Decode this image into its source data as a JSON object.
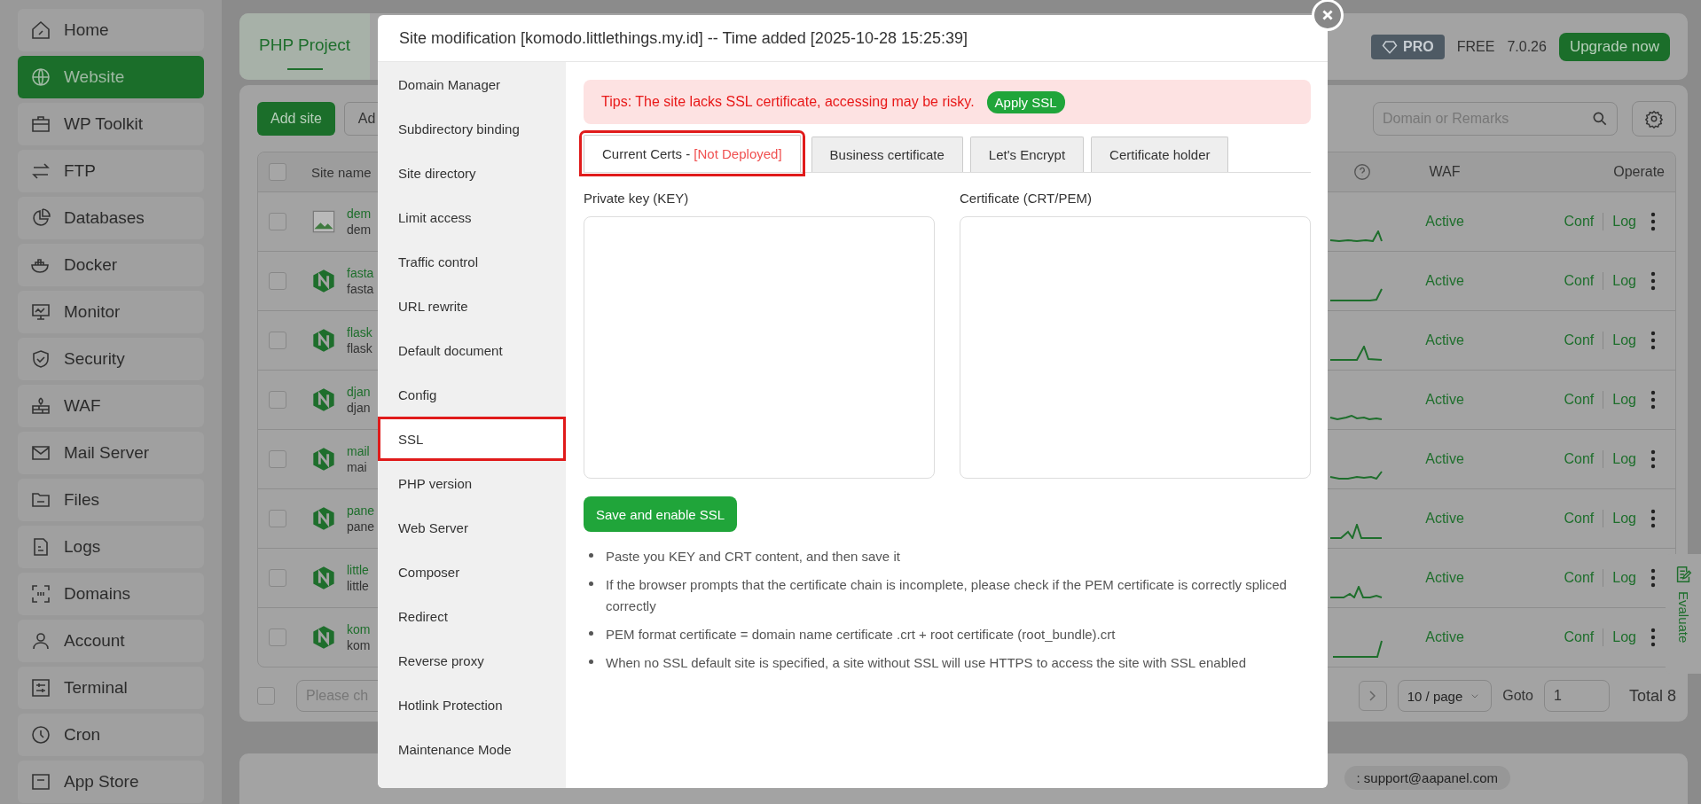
{
  "sidebar": {
    "items": [
      {
        "label": "Home",
        "selected": false
      },
      {
        "label": "Website",
        "selected": true
      },
      {
        "label": "WP Toolkit",
        "selected": false
      },
      {
        "label": "FTP",
        "selected": false
      },
      {
        "label": "Databases",
        "selected": false
      },
      {
        "label": "Docker",
        "selected": false
      },
      {
        "label": "Monitor",
        "selected": false
      },
      {
        "label": "Security",
        "selected": false
      },
      {
        "label": "WAF",
        "selected": false
      },
      {
        "label": "Mail Server",
        "selected": false
      },
      {
        "label": "Files",
        "selected": false
      },
      {
        "label": "Logs",
        "selected": false
      },
      {
        "label": "Domains",
        "selected": false
      },
      {
        "label": "Account",
        "selected": false
      },
      {
        "label": "Terminal",
        "selected": false
      },
      {
        "label": "Cron",
        "selected": false
      },
      {
        "label": "App Store",
        "selected": false
      }
    ]
  },
  "header": {
    "tabs": [
      {
        "label": "PHP Project",
        "selected": true
      }
    ],
    "badge": "PRO",
    "edition": "FREE",
    "version": "7.0.26",
    "upgrade_button": "Upgrade now"
  },
  "toolbar": {
    "add_button": "Add site",
    "second_button": "Ad",
    "search": {
      "placeholder": "Domain or Remarks"
    }
  },
  "table": {
    "checked": false,
    "columns": [
      "Site name",
      "WAF",
      "Operate"
    ],
    "rows": [
      {
        "kind": "image",
        "name": "dem",
        "note": "dem",
        "waf": "Active",
        "actions": [
          "Conf",
          "Log"
        ],
        "checked": false
      },
      {
        "kind": "hexagon",
        "name": "fasta",
        "note": "fasta",
        "waf": "Active",
        "actions": [
          "Conf",
          "Log"
        ],
        "checked": false
      },
      {
        "kind": "hexagon",
        "name": "flask",
        "note": "flask",
        "waf": "Active",
        "actions": [
          "Conf",
          "Log"
        ],
        "checked": false
      },
      {
        "kind": "hexagon",
        "name": "djan",
        "note": "djan",
        "waf": "Active",
        "actions": [
          "Conf",
          "Log"
        ],
        "checked": false
      },
      {
        "kind": "hexagon",
        "name": "mail",
        "note": "mai",
        "waf": "Active",
        "actions": [
          "Conf",
          "Log"
        ],
        "checked": false
      },
      {
        "kind": "hexagon",
        "name": "pane",
        "note": "pane",
        "waf": "Active",
        "actions": [
          "Conf",
          "Log"
        ],
        "checked": false
      },
      {
        "kind": "hexagon",
        "name": "little",
        "note": "little",
        "waf": "Active",
        "actions": [
          "Conf",
          "Log"
        ],
        "checked": false
      },
      {
        "kind": "hexagon",
        "name": "kom",
        "note": "kom",
        "waf": "Active",
        "actions": [
          "Conf",
          "Log"
        ],
        "checked": false
      }
    ]
  },
  "pagination": {
    "checked": false,
    "batch_placeholder": "Please ch",
    "page_size": "10 / page",
    "goto_label": "Goto",
    "goto_value": "1",
    "total": "Total 8"
  },
  "footer": {
    "contact": ": support@aapanel.com"
  },
  "evaluate": "Evaluate",
  "modal": {
    "title": "Site modification [komodo.littlethings.my.id] -- Time added [2025-10-28 15:25:39]",
    "nav": [
      {
        "label": "Domain Manager",
        "selected": false
      },
      {
        "label": "Subdirectory binding",
        "selected": false
      },
      {
        "label": "Site directory",
        "selected": false
      },
      {
        "label": "Limit access",
        "selected": false
      },
      {
        "label": "Traffic control",
        "selected": false
      },
      {
        "label": "URL rewrite",
        "selected": false
      },
      {
        "label": "Default document",
        "selected": false
      },
      {
        "label": "Config",
        "selected": false
      },
      {
        "label": "SSL",
        "selected": true
      },
      {
        "label": "PHP version",
        "selected": false
      },
      {
        "label": "Web Server",
        "selected": false
      },
      {
        "label": "Composer",
        "selected": false
      },
      {
        "label": "Redirect",
        "selected": false
      },
      {
        "label": "Reverse proxy",
        "selected": false
      },
      {
        "label": "Hotlink Protection",
        "selected": false
      },
      {
        "label": "Maintenance Mode",
        "selected": false
      }
    ],
    "tip": {
      "text": "Tips: The site lacks SSL certificate, accessing may be risky.",
      "button": "Apply SSL"
    },
    "tabs": [
      {
        "label": "Current Certs -",
        "status": "[Not Deployed]",
        "selected": true
      },
      {
        "label": "Business certificate",
        "selected": false
      },
      {
        "label": "Let's Encrypt",
        "selected": false
      },
      {
        "label": "Certificate holder",
        "selected": false
      }
    ],
    "key_field": {
      "label": "Private key (KEY)"
    },
    "cert_field": {
      "label": "Certificate (CRT/PEM)"
    },
    "save_button": "Save and enable SSL",
    "notes": [
      "Paste you KEY and CRT content, and then save it",
      "If the browser prompts that the certificate chain is incomplete, please check if the PEM certificate is correctly spliced correctly",
      "PEM format certificate = domain name certificate .crt + root certificate (root_bundle).crt",
      "When no SSL default site is specified, a site without SSL will use HTTPS to access the site with SSL enabled"
    ]
  }
}
